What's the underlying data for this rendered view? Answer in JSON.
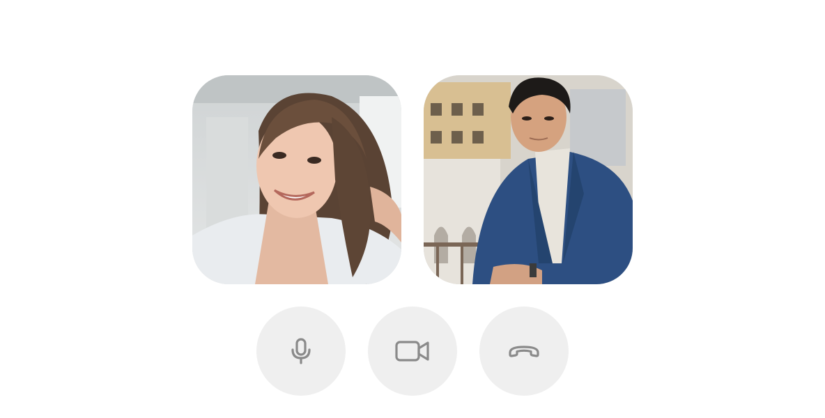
{
  "call": {
    "participants": [
      {
        "id": "participant-1"
      },
      {
        "id": "participant-2"
      }
    ],
    "controls": [
      {
        "icon": "microphone-icon"
      },
      {
        "icon": "video-camera-icon"
      },
      {
        "icon": "hang-up-phone-icon"
      }
    ]
  },
  "colors": {
    "background": "#ffffff",
    "control_fill": "#efefef",
    "icon_stroke": "#8a8a8a"
  }
}
